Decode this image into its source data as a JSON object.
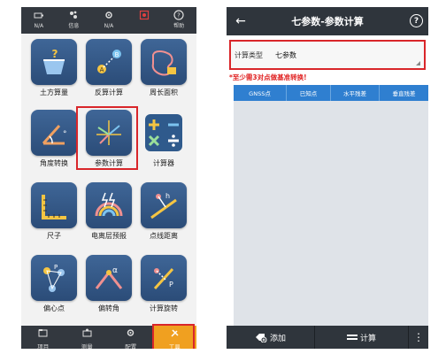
{
  "left": {
    "topbar": [
      {
        "label": "N/A",
        "icon": "satellite-icon",
        "red": false
      },
      {
        "label": "信息",
        "icon": "info-icon",
        "red": false
      },
      {
        "label": "N/A",
        "icon": "gear-signal-icon",
        "red": false
      },
      {
        "label": "",
        "icon": "record-icon",
        "red": true
      },
      {
        "label": "帮助",
        "icon": "help-icon",
        "red": false
      }
    ],
    "tiles": [
      {
        "label": "土方算量",
        "icon": "earthwork-icon"
      },
      {
        "label": "反算计算",
        "icon": "inverse-calc-icon"
      },
      {
        "label": "周长面积",
        "icon": "perimeter-area-icon"
      },
      {
        "label": "角度转换",
        "icon": "angle-convert-icon"
      },
      {
        "label": "参数计算",
        "icon": "parameter-calc-icon"
      },
      {
        "label": "计算器",
        "icon": "calculator-icon"
      },
      {
        "label": "尺子",
        "icon": "ruler-icon"
      },
      {
        "label": "电离层预报",
        "icon": "ionosphere-icon"
      },
      {
        "label": "点线距离",
        "icon": "point-line-distance-icon"
      },
      {
        "label": "偏心点",
        "icon": "eccentric-point-icon"
      },
      {
        "label": "偏转角",
        "icon": "deflection-angle-icon"
      },
      {
        "label": "计算旋转",
        "icon": "rotation-calc-icon"
      }
    ],
    "bottombar": [
      {
        "label": "项目",
        "icon": "project-icon"
      },
      {
        "label": "测量",
        "icon": "survey-icon"
      },
      {
        "label": "配置",
        "icon": "config-icon"
      },
      {
        "label": "工具",
        "icon": "tools-icon"
      }
    ]
  },
  "right": {
    "title": "七参数-参数计算",
    "calc_type_label": "计算类型",
    "calc_type_value": "七参数",
    "warning": "*至少需3对点做基准转换!",
    "columns": [
      "GNSS点",
      "已知点",
      "水平残差",
      "垂直残差"
    ],
    "buttons": {
      "add": "添加",
      "compute": "计算",
      "more": "⋮"
    }
  },
  "colors": {
    "accent": "#f0a020",
    "highlight": "#d9262a",
    "header": "#2f7fd0",
    "bar": "#33383f",
    "tile": "#34598a"
  }
}
